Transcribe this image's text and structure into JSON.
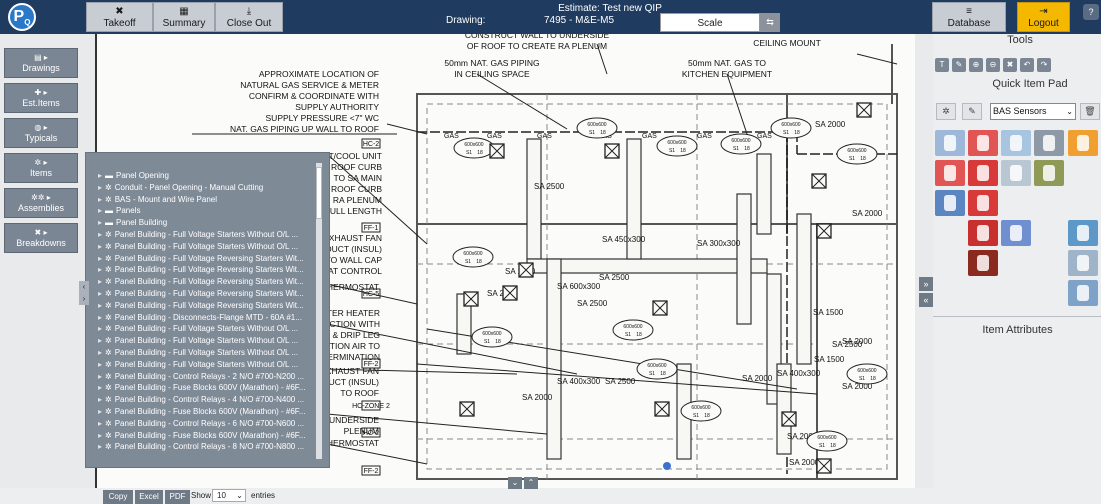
{
  "app": {
    "logo_text": "P",
    "logo_sub": "Q"
  },
  "toolbar": {
    "takeoff": "Takeoff",
    "summary": "Summary",
    "close_out": "Close Out",
    "database": "Database",
    "logout": "Logout"
  },
  "estimate": {
    "title": "Estimate: Test new QIP",
    "drawing_label": "Drawing:",
    "drawing_value": "7495 - M&E-M5"
  },
  "scale": {
    "label": "Scale"
  },
  "nav": {
    "drawings": "Drawings",
    "est_items": "Est.Items",
    "typicals": "Typicals",
    "items": "Items",
    "assemblies": "Assemblies",
    "breakdowns": "Breakdowns"
  },
  "tree": {
    "items": [
      "Panel Opening",
      "Conduit - Panel Opening - Manual Cutting",
      "BAS - Mount and Wire Panel",
      "Panels",
      "Panel Building",
      "Panel Building - Full Voltage Starters Without O/L ...",
      "Panel Building - Full Voltage Starters Without O/L ...",
      "Panel Building - Full Voltage Reversing Starters Wit...",
      "Panel Building - Full Voltage Reversing Starters Wit...",
      "Panel Building - Full Voltage Reversing Starters Wit...",
      "Panel Building - Full Voltage Reversing Starters Wit...",
      "Panel Building - Full Voltage Reversing Starters Wit...",
      "Panel Building - Disconnects-Flange MTD - 60A #1...",
      "Panel Building - Full Voltage Starters Without O/L ...",
      "Panel Building - Full Voltage Starters Without O/L ...",
      "Panel Building - Full Voltage Starters Without O/L ...",
      "Panel Building - Full Voltage Starters Without O/L ...",
      "Panel Building - Control Relays - 2 N/O #700-N200 ...",
      "Panel Building - Fuse Blocks 600V (Marathon) - #6F...",
      "Panel Building - Control Relays - 4 N/O #700-N400 ...",
      "Panel Building - Fuse Blocks 600V (Marathon) - #6F...",
      "Panel Building - Control Relays - 6 N/O #700-N600 ...",
      "Panel Building - Fuse Blocks 600V (Marathon) - #6F...",
      "Panel Building - Control Relays - 8 N/O #700-N800 ..."
    ],
    "folder_indices": [
      0,
      3,
      4
    ]
  },
  "drawing_text": {
    "gas_location": [
      "APPROXIMATE LOCATION OF",
      "NATURAL GAS SERVICE & METER",
      "CONFIRM & COORDINATE WITH",
      "SUPPLY AUTHORITY",
      "SUPPLY PRESSURE <7\" WC",
      "NAT. GAS PIPING UP WALL TO ROOF"
    ],
    "gas_ceiling": [
      "50mm NAT. GAS PIPING",
      "IN CEILING SPACE"
    ],
    "gas_kitchen": [
      "50mm NAT. GAS TO",
      "KITCHEN EQUIPMENT"
    ],
    "ra_plenum": [
      "CONSTRUCT WALL TO UNDERSIDE",
      "OF ROOF TO CREATE RA PLENUM"
    ],
    "ceiling_mount": "CEILING MOUNT",
    "heat_cool": [
      "HEAT/COOL UNIT",
      "ROOF CURB",
      "TO SA MAIN",
      "ROOF CURB",
      "RA PLENUM",
      "FULL LENGTH"
    ],
    "exhaust_fan": [
      "EXHAUST FAN",
      "DUCT (INSUL)",
      "TO WALL CAP",
      "AT CONTROL"
    ],
    "thermostat": "THERMOSTAT",
    "water_heater": [
      "WATER HEATER",
      "CONNECTION WITH",
      "& DRIP LEG",
      "COMBUSTION AIR TO",
      "TERMINATION"
    ],
    "exhaust_fan2": [
      "EXHAUST FAN",
      "DUCT (INSUL)",
      "TO ROOF"
    ],
    "underside": [
      "UNDERSIDE",
      "PLENUM"
    ],
    "hc_tags": [
      "HC-2",
      "FF-1",
      "HC-5",
      "FF-2",
      "HC-ZONE 2",
      "HC-2",
      "FF-2"
    ],
    "duct_labels": [
      "SA 2000",
      "SA 2500",
      "SA 450x300",
      "SA 300x300",
      "SA 1500",
      "SA 2500",
      "SA 2500",
      "SA 600x300",
      "SA 400x300",
      "SA 2500",
      "SA 2000",
      "SA 2000",
      "SA 1500",
      "SA 2500",
      "SA 1500",
      "SA 2500",
      "SA 2000",
      "SA 2000",
      "SA 400x300",
      "SA 2000",
      "SA 2000",
      "SA 2000"
    ],
    "gas_label": "GAS",
    "diffuser_vals": [
      "600x600",
      "S1",
      "18"
    ]
  },
  "right": {
    "tools_title": "Tools",
    "quick_pad_title": "Quick Item Pad",
    "quick_pad_select": "BAS Sensors",
    "item_attributes_title": "Item Attributes"
  },
  "bottom": {
    "copy": "Copy",
    "excel": "Excel",
    "pdf": "PDF",
    "show": "Show",
    "show_value": "10",
    "entries": "entries"
  },
  "colors": {
    "topbar": "#1f3b60",
    "logout": "#f4b800",
    "nav_button": "#7b8694",
    "tree_bg": "#7f8a97"
  }
}
